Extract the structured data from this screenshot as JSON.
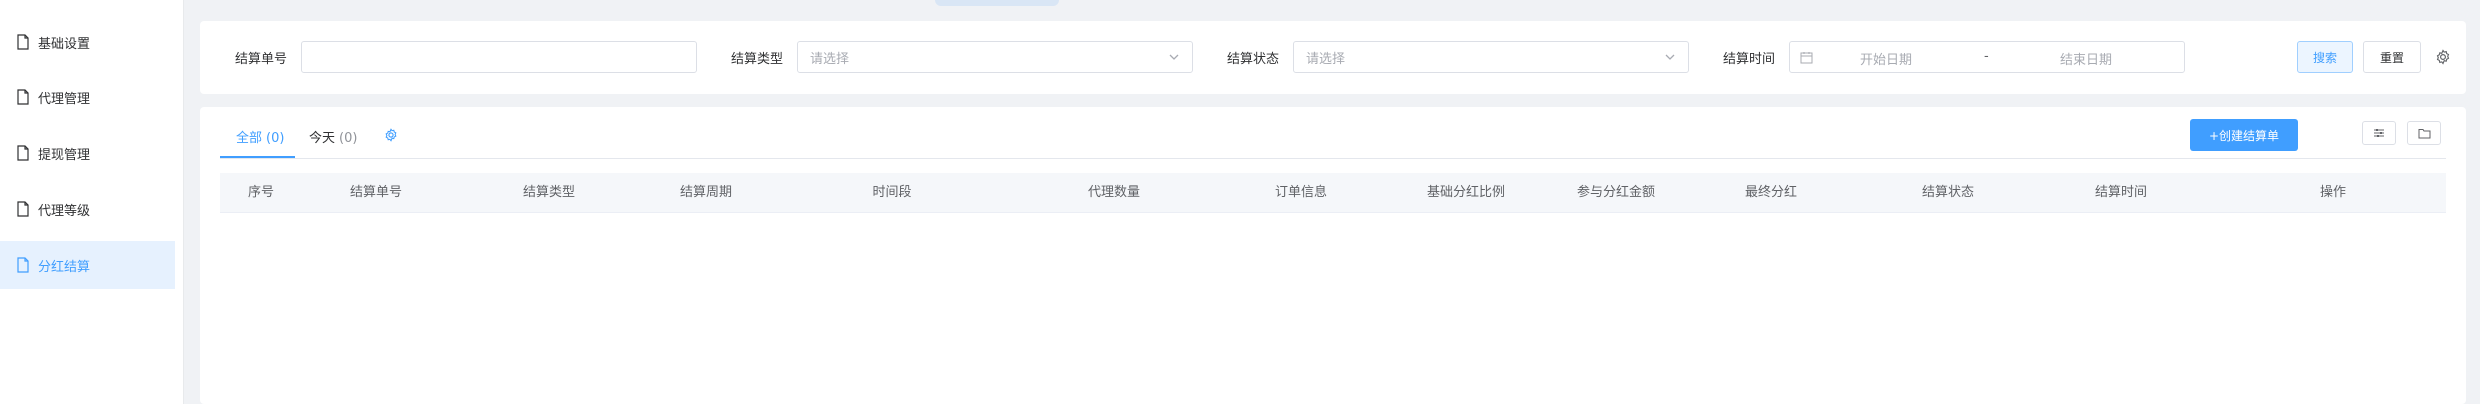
{
  "sidebar": {
    "items": [
      {
        "label": "基础设置",
        "active": false
      },
      {
        "label": "代理管理",
        "active": false
      },
      {
        "label": "提现管理",
        "active": false
      },
      {
        "label": "代理等级",
        "active": false
      },
      {
        "label": "分红结算",
        "active": true
      }
    ]
  },
  "filters": {
    "settlement_no": {
      "label": "结算单号",
      "value": ""
    },
    "settlement_type": {
      "label": "结算类型",
      "placeholder": "请选择"
    },
    "settlement_status": {
      "label": "结算状态",
      "placeholder": "请选择"
    },
    "settlement_time": {
      "label": "结算时间",
      "start_placeholder": "开始日期",
      "separator": "-",
      "end_placeholder": "结束日期"
    },
    "search_label": "搜索",
    "reset_label": "重置"
  },
  "tabs": [
    {
      "label": "全部",
      "count": "(0)",
      "active": true
    },
    {
      "label": "今天",
      "count": "(0)",
      "active": false
    }
  ],
  "toolbar": {
    "create_label": "+创建结算单"
  },
  "table": {
    "columns": [
      "序号",
      "结算单号",
      "结算类型",
      "结算周期",
      "时间段",
      "代理数量",
      "订单信息",
      "基础分红比例",
      "参与分红金额",
      "最终分红",
      "结算状态",
      "结算时间",
      "操作"
    ],
    "rows": []
  },
  "colors": {
    "accent": "#409eff",
    "active_bg": "#e6f1fe",
    "header_bg": "#f5f7fa"
  },
  "icons": {
    "sidebar": "document-icon",
    "settings": "gear-icon",
    "select": "chevron-down-icon",
    "date": "calendar-icon",
    "column_filter": "sliders-icon",
    "folder": "folder-icon"
  }
}
